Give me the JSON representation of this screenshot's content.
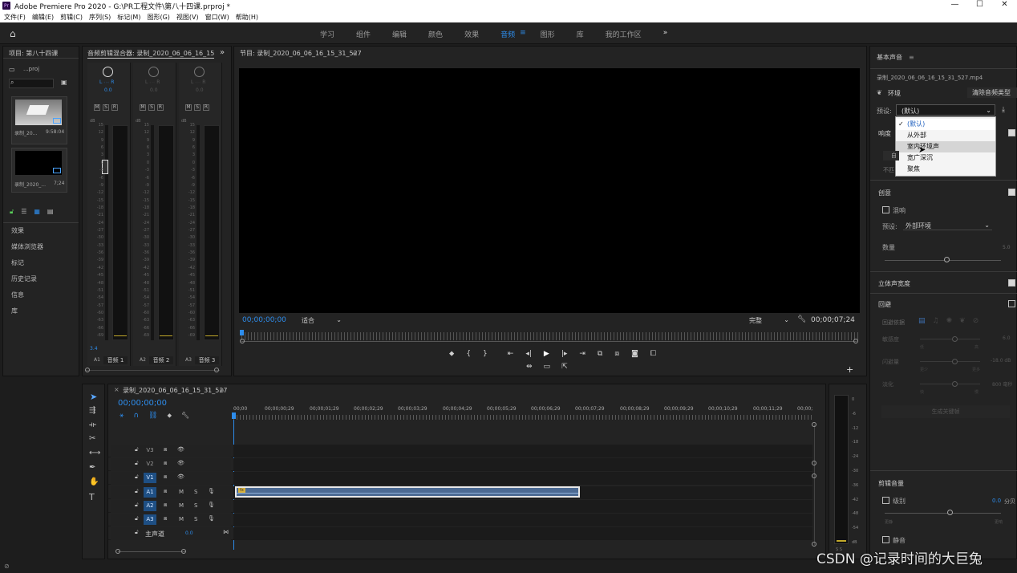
{
  "titlebar": {
    "title": "Adobe Premiere Pro 2020 - G:\\PR工程文件\\第八十四课.prproj *",
    "logo": "Pr"
  },
  "menu": [
    "文件(F)",
    "编辑(E)",
    "剪辑(C)",
    "序列(S)",
    "标记(M)",
    "图形(G)",
    "视图(V)",
    "窗口(W)",
    "帮助(H)"
  ],
  "workspaces": {
    "tabs": [
      "学习",
      "组件",
      "编辑",
      "颜色",
      "效果",
      "音频",
      "图形",
      "库",
      "我的工作区"
    ],
    "active": "音频",
    "active_menu_icon": "≡",
    "more_icon": "»"
  },
  "project": {
    "title": "项目: 第八十四课",
    "file": "...proj",
    "clips": [
      {
        "name": "录制_20...",
        "duration": "9:58:04"
      },
      {
        "name": "录制_2020_...",
        "duration": "7;24"
      }
    ],
    "panels": [
      "效果",
      "媒体浏览器",
      "标记",
      "历史记录",
      "信息",
      "库"
    ]
  },
  "mixer": {
    "title": "音频剪辑混合器: 录制_2020_06_06_16_15",
    "channels": [
      {
        "track": "A1",
        "name": "音频 1",
        "pan_label": "L",
        "pan_label_r": "R",
        "value": "0.0",
        "meter": "3.4"
      },
      {
        "track": "A2",
        "name": "音频 2",
        "pan_label": "L",
        "pan_label_r": "R",
        "value": "0.0",
        "meter": ""
      },
      {
        "track": "A3",
        "name": "音频 3",
        "pan_label": "L",
        "pan_label_r": "R",
        "value": "0.0",
        "meter": ""
      }
    ],
    "msr": [
      "M",
      "S",
      "R"
    ],
    "db_label": "dB",
    "scale": [
      "15",
      "12",
      "9",
      "6",
      "3",
      "0",
      "-3",
      "-6",
      "-9",
      "-12",
      "-15",
      "-18",
      "-21",
      "-24",
      "-27",
      "-30",
      "-33",
      "-36",
      "-39",
      "-42",
      "-45",
      "-48",
      "-51",
      "-54",
      "-57",
      "-60",
      "-63",
      "-66",
      "-69"
    ]
  },
  "program": {
    "title": "节目: 录制_2020_06_06_16_15_31_527",
    "timecode": "00;00;00;00",
    "fit": "适合",
    "quality": "完整",
    "duration": "00;00;07;24"
  },
  "timeline": {
    "title": "录制_2020_06_06_16_15_31_527",
    "timecode": "00;00;00;00",
    "ruler": [
      "00;00",
      "00;00;00;29",
      "00;00;01;29",
      "00;00;02;29",
      "00;00;03;29",
      "00;00;04;29",
      "00;00;05;29",
      "00;00;06;29",
      "00;00;07;29",
      "00;00;08;29",
      "00;00;09;29",
      "00;00;10;29",
      "00;00;11;29",
      "00;00;"
    ],
    "video_tracks": [
      "V3",
      "V2",
      "V1"
    ],
    "audio_tracks": [
      "A1",
      "A2",
      "A3"
    ],
    "master": {
      "label": "主声道",
      "value": "0.0"
    },
    "clip_marker": "fx",
    "meter_scale": [
      "0",
      "-6",
      "-12",
      "-18",
      "-24",
      "-30",
      "-36",
      "-42",
      "-48",
      "-54",
      "dB"
    ],
    "meter_bottom": "S  S"
  },
  "essential_sound": {
    "title": "基本声音",
    "clip": "录制_2020_06_06_16_15_31_527.mp4",
    "type_label": "环境",
    "clear_button": "清除音频类型",
    "preset_label": "预设:",
    "preset_value": "(默认)",
    "dropdown_items": [
      "(默认)",
      "从外部",
      "室内环境声",
      "宽广深沉",
      "聚焦"
    ],
    "dropdown_selected": "(默认)",
    "dropdown_hover": "室内环境声",
    "loudness": "响度",
    "auto_btn": "自",
    "nonbtn": "不匹",
    "creative": "创意",
    "reverb": "混响",
    "reverb_preset_label": "预设:",
    "reverb_preset": "外部环境",
    "amount": "数量",
    "amount_min": "",
    "amount_max": "5.0",
    "stereo": "立体声宽度",
    "ducking": "回避",
    "duck_against": "回避依据",
    "sensitivity": "敏感度",
    "sens_low": "低",
    "sens_high": "高",
    "sens_value": "6.0",
    "duck_amount": "闪避量",
    "duck_less": "更少",
    "duck_more": "更多",
    "duck_value": "-18.0 dB",
    "fade": "淡化",
    "fade_fast": "快",
    "fade_slow": "慢",
    "fade_value": "800 毫秒",
    "generate_keyframes": "生成关键帧",
    "clip_volume": "剪辑音量",
    "level": "级别",
    "level_value": "0.0",
    "level_unit": "分贝",
    "quieter": "更静",
    "louder": "更响",
    "mute": "静音"
  },
  "watermark": "CSDN @记录时间的大巨兔"
}
